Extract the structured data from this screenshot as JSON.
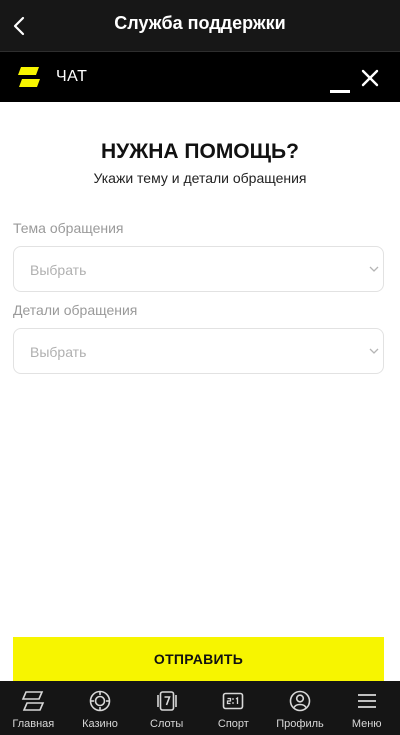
{
  "header": {
    "title": "Служба поддержки"
  },
  "chat": {
    "title": "ЧАТ"
  },
  "form": {
    "title": "НУЖНА ПОМОЩЬ?",
    "subtitle": "Укажи тему и детали обращения",
    "topic_label": "Тема обращения",
    "topic_value": "Выбрать",
    "details_label": "Детали обращения",
    "details_value": "Выбрать",
    "submit_label": "ОТПРАВИТЬ"
  },
  "nav": {
    "items": [
      {
        "label": "Главная",
        "icon": "home-logo-icon"
      },
      {
        "label": "Казино",
        "icon": "casino-chip-icon"
      },
      {
        "label": "Слоты",
        "icon": "slots-icon"
      },
      {
        "label": "Спорт",
        "icon": "sport-score-icon"
      },
      {
        "label": "Профиль",
        "icon": "profile-icon"
      },
      {
        "label": "Меню",
        "icon": "menu-icon"
      }
    ]
  },
  "colors": {
    "accent": "#f7f500",
    "dark": "#171717",
    "chat_bar": "#000000"
  }
}
